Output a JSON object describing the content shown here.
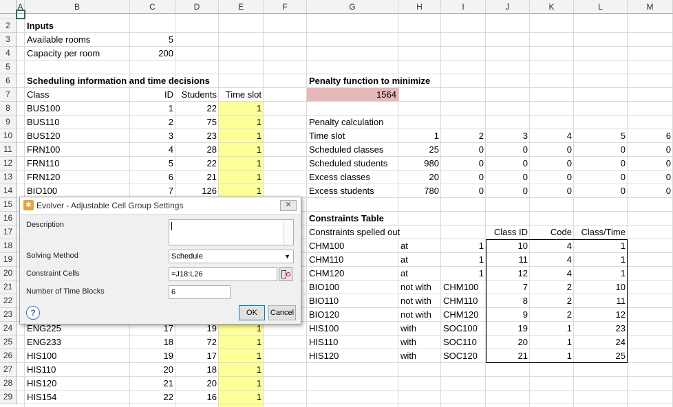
{
  "columns": [
    "A",
    "B",
    "C",
    "D",
    "E",
    "F",
    "G",
    "H",
    "I",
    "J",
    "K",
    "L",
    "M"
  ],
  "rows": [
    "2",
    "3",
    "4",
    "5",
    "6",
    "7",
    "8",
    "9",
    "10",
    "11",
    "12",
    "13",
    "14",
    "15",
    "16",
    "17",
    "18",
    "19",
    "20",
    "21",
    "22",
    "23",
    "24",
    "25",
    "26",
    "27",
    "28",
    "29"
  ],
  "inputs": {
    "heading": "Inputs",
    "rooms_label": "Available rooms",
    "rooms_value": "5",
    "capacity_label": "Capacity per room",
    "capacity_value": "200"
  },
  "scheduling": {
    "heading": "Scheduling information and time decisions",
    "headers": {
      "class": "Class",
      "id": "ID",
      "students": "Students",
      "timeslot": "Time slot"
    },
    "rows": [
      {
        "row": 8,
        "class": "BUS100",
        "id": "1",
        "students": "22",
        "slot": "1"
      },
      {
        "row": 9,
        "class": "BUS110",
        "id": "2",
        "students": "75",
        "slot": "1"
      },
      {
        "row": 10,
        "class": "BUS120",
        "id": "3",
        "students": "23",
        "slot": "1"
      },
      {
        "row": 11,
        "class": "FRN100",
        "id": "4",
        "students": "28",
        "slot": "1"
      },
      {
        "row": 12,
        "class": "FRN110",
        "id": "5",
        "students": "22",
        "slot": "1"
      },
      {
        "row": 13,
        "class": "FRN120",
        "id": "6",
        "students": "21",
        "slot": "1"
      },
      {
        "row": 14,
        "class": "BIO100",
        "id": "7",
        "students": "126",
        "slot": "1"
      },
      {
        "row": 24,
        "class": "ENG225",
        "id": "17",
        "students": "19",
        "slot": "1"
      },
      {
        "row": 25,
        "class": "ENG233",
        "id": "18",
        "students": "72",
        "slot": "1"
      },
      {
        "row": 26,
        "class": "HIS100",
        "id": "19",
        "students": "17",
        "slot": "1"
      },
      {
        "row": 27,
        "class": "HIS110",
        "id": "20",
        "students": "18",
        "slot": "1"
      },
      {
        "row": 28,
        "class": "HIS120",
        "id": "21",
        "students": "20",
        "slot": "1"
      },
      {
        "row": 29,
        "class": "HIS154",
        "id": "22",
        "students": "16",
        "slot": "1"
      }
    ]
  },
  "penalty": {
    "heading": "Penalty function to minimize",
    "value": "1564",
    "calc_label": "Penalty calculation",
    "labels": [
      "Time slot",
      "Scheduled classes",
      "Scheduled students",
      "Excess classes",
      "Excess students"
    ],
    "values": [
      [
        "1",
        "2",
        "3",
        "4",
        "5",
        "6"
      ],
      [
        "25",
        "0",
        "0",
        "0",
        "0",
        "0"
      ],
      [
        "980",
        "0",
        "0",
        "0",
        "0",
        "0"
      ],
      [
        "20",
        "0",
        "0",
        "0",
        "0",
        "0"
      ],
      [
        "780",
        "0",
        "0",
        "0",
        "0",
        "0"
      ]
    ]
  },
  "constraints": {
    "heading": "Constraints Table",
    "spelled_label": "Constraints spelled out",
    "headers": {
      "class_id": "Class ID",
      "code": "Code",
      "class_time": "Class/Time"
    },
    "rows": [
      {
        "a": "CHM100",
        "rel": "at",
        "b": "1",
        "id": "10",
        "code": "4",
        "ct": "1"
      },
      {
        "a": "CHM110",
        "rel": "at",
        "b": "1",
        "id": "11",
        "code": "4",
        "ct": "1"
      },
      {
        "a": "CHM120",
        "rel": "at",
        "b": "1",
        "id": "12",
        "code": "4",
        "ct": "1"
      },
      {
        "a": "BIO100",
        "rel": "not with",
        "b": "CHM100",
        "id": "7",
        "code": "2",
        "ct": "10"
      },
      {
        "a": "BIO110",
        "rel": "not with",
        "b": "CHM110",
        "id": "8",
        "code": "2",
        "ct": "11"
      },
      {
        "a": "BIO120",
        "rel": "not with",
        "b": "CHM120",
        "id": "9",
        "code": "2",
        "ct": "12"
      },
      {
        "a": "HIS100",
        "rel": "with",
        "b": "SOC100",
        "id": "19",
        "code": "1",
        "ct": "23"
      },
      {
        "a": "HIS110",
        "rel": "with",
        "b": "SOC110",
        "id": "20",
        "code": "1",
        "ct": "24"
      },
      {
        "a": "HIS120",
        "rel": "with",
        "b": "SOC120",
        "id": "21",
        "code": "1",
        "ct": "25"
      }
    ]
  },
  "dialog": {
    "title": "Evolver - Adjustable Cell Group Settings",
    "description_label": "Description",
    "description_value": "",
    "solving_label": "Solving Method",
    "solving_value": "Schedule",
    "constraint_label": "Constraint Cells",
    "constraint_value": "=J18:L26",
    "timeblocks_label": "Number of Time Blocks",
    "timeblocks_value": "6",
    "ok_label": "OK",
    "cancel_label": "Cancel",
    "close_glyph": "✕",
    "help_glyph": "?"
  },
  "colors": {
    "timeslot_fill": "#ffff99",
    "penalty_fill": "#e6b8b7",
    "selection": "#217346"
  }
}
